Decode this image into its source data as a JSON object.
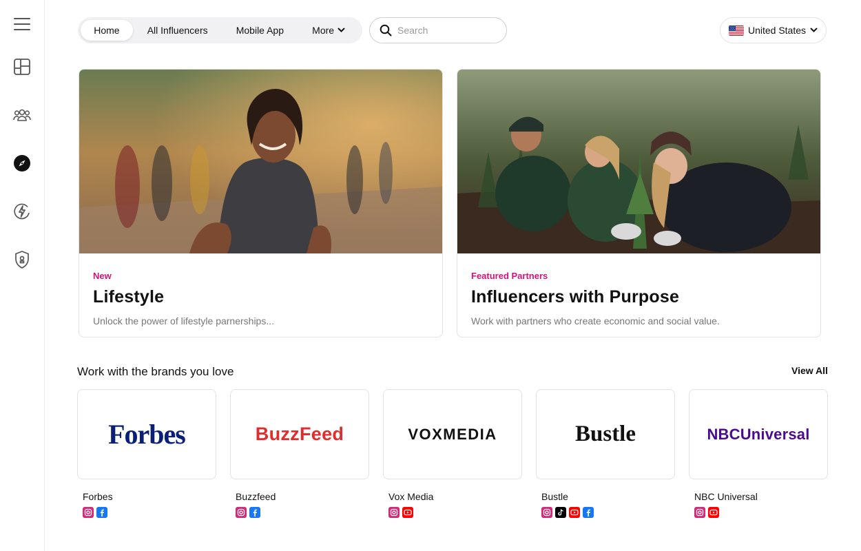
{
  "nav": {
    "items": [
      {
        "label": "Home",
        "active": true
      },
      {
        "label": "All Influencers",
        "active": false
      },
      {
        "label": "Mobile App",
        "active": false
      },
      {
        "label": "More",
        "active": false
      }
    ]
  },
  "search": {
    "placeholder": "Search"
  },
  "country": {
    "label": "United States",
    "flag": "us-flag-icon"
  },
  "sidebar": {
    "icons": [
      "menu-icon",
      "dashboard-icon",
      "users-icon",
      "compass-icon",
      "lightning-icon",
      "shield-icon"
    ],
    "active": "compass-icon"
  },
  "cards": [
    {
      "tag": "New",
      "title": "Lifestyle",
      "description": "Unlock the power of lifestyle parnerships..."
    },
    {
      "tag": "Featured Partners",
      "title": "Influencers with Purpose",
      "description": "Work with partners who create economic and social value."
    }
  ],
  "brands_section": {
    "title": "Work with the brands you love",
    "view_all": "View All",
    "brands": [
      {
        "name": "Forbes",
        "logo_text": "Forbes",
        "socials": [
          "instagram-icon",
          "facebook-icon"
        ]
      },
      {
        "name": "Buzzfeed",
        "logo_text": "BuzzFeed",
        "socials": [
          "instagram-icon",
          "facebook-icon"
        ]
      },
      {
        "name": "Vox Media",
        "logo_text": "VOXMEDIA",
        "socials": [
          "instagram-icon",
          "youtube-icon"
        ]
      },
      {
        "name": "Bustle",
        "logo_text": "Bustle",
        "socials": [
          "instagram-icon",
          "tiktok-icon",
          "youtube-icon",
          "facebook-icon"
        ]
      },
      {
        "name": "NBC Universal",
        "logo_text": "NBCUniversal",
        "socials": [
          "instagram-icon",
          "youtube-icon"
        ]
      }
    ]
  },
  "colors": {
    "accent": "#d4127a",
    "instagram": "#d62976",
    "facebook": "#1877f2",
    "youtube": "#ff0000",
    "tiktok": "#000000"
  }
}
